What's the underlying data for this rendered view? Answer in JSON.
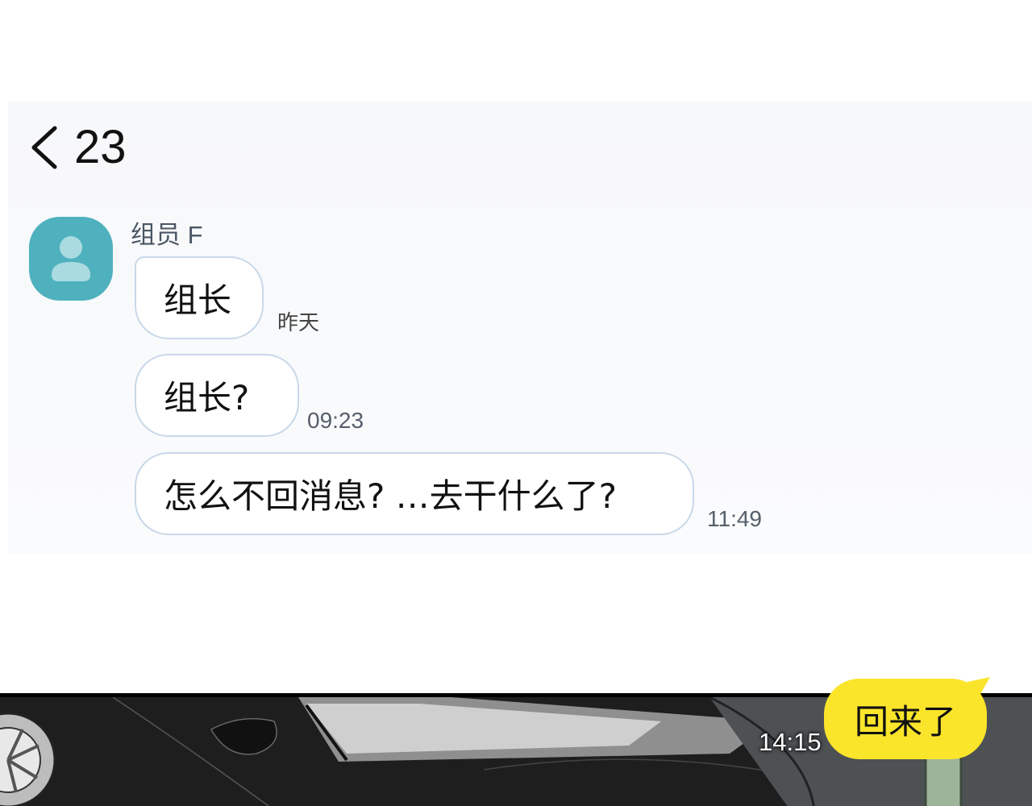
{
  "header": {
    "back_icon": "chevron-left-icon",
    "title": "23"
  },
  "contact": {
    "name": "组员 F",
    "avatar_icon": "person-icon",
    "avatar_color": "#4fb1be"
  },
  "messages_incoming": [
    {
      "text": "组长",
      "time": "昨天"
    },
    {
      "text": "组长?",
      "time": "09:23"
    },
    {
      "text": "怎么不回消息? …去干什么了?",
      "time": "11:49"
    }
  ],
  "message_outgoing": {
    "text": "回来了",
    "time": "14:15",
    "color": "#fbe52b"
  },
  "colors": {
    "bubble_border": "#c9d8e8",
    "timestamp": "#555f6b"
  }
}
